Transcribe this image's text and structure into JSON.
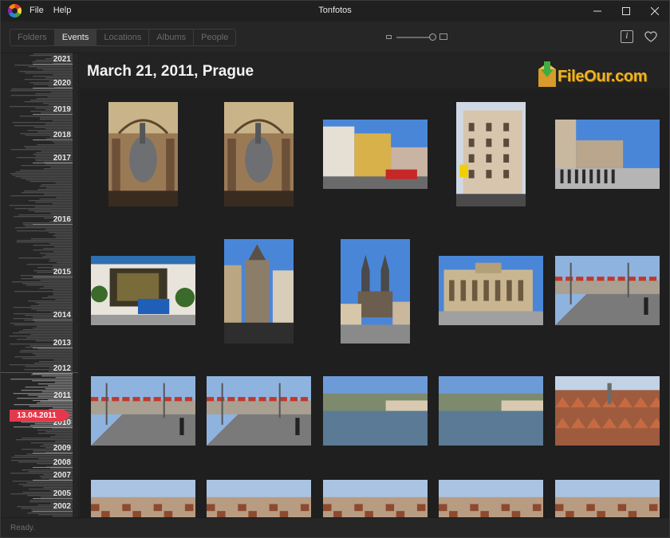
{
  "titlebar": {
    "title": "Tonfotos",
    "menu": [
      {
        "label": "File"
      },
      {
        "label": "Help"
      }
    ]
  },
  "toolbar": {
    "tabs": [
      {
        "label": "Folders",
        "active": false
      },
      {
        "label": "Events",
        "active": true
      },
      {
        "label": "Locations",
        "active": false
      },
      {
        "label": "Albums",
        "active": false
      },
      {
        "label": "People",
        "active": false
      }
    ],
    "info_label": "i"
  },
  "timeline": {
    "years": [
      "2021",
      "2020",
      "2019",
      "2018",
      "2017",
      "2016",
      "2015",
      "2014",
      "2013",
      "2012",
      "2011",
      "2010",
      "2009",
      "2008",
      "2007",
      "2005",
      "2002"
    ],
    "current_date": "13.04.2011"
  },
  "event": {
    "title": "March 21, 2011, Prague"
  },
  "watermark": {
    "text": "FileOur.com"
  },
  "photos": [
    {
      "name": "photo-horse-sculpture-1",
      "scene": "sculpture"
    },
    {
      "name": "photo-horse-sculpture-2",
      "scene": "sculpture"
    },
    {
      "name": "photo-street-buildings-tram",
      "scene": "street"
    },
    {
      "name": "photo-corner-building",
      "scene": "building"
    },
    {
      "name": "photo-wenceslas-square",
      "scene": "square"
    },
    {
      "name": "photo-shop-blue-bench",
      "scene": "shop"
    },
    {
      "name": "photo-old-town-tower",
      "scene": "tower"
    },
    {
      "name": "photo-tyn-church",
      "scene": "church"
    },
    {
      "name": "photo-rudolfinum",
      "scene": "hall"
    },
    {
      "name": "photo-bridge-castle-view",
      "scene": "bridge"
    },
    {
      "name": "photo-bridge-walkers-1",
      "scene": "bridge"
    },
    {
      "name": "photo-bridge-walkers-2",
      "scene": "bridge"
    },
    {
      "name": "photo-vltava-river-1",
      "scene": "river"
    },
    {
      "name": "photo-vltava-river-2",
      "scene": "river"
    },
    {
      "name": "photo-rooftops-panorama",
      "scene": "roofs"
    },
    {
      "name": "photo-city-panorama-1",
      "scene": "panorama"
    },
    {
      "name": "photo-city-panorama-2",
      "scene": "panorama"
    },
    {
      "name": "photo-city-panorama-3",
      "scene": "panorama"
    },
    {
      "name": "photo-city-panorama-4",
      "scene": "panorama"
    },
    {
      "name": "photo-city-panorama-5",
      "scene": "panorama"
    }
  ],
  "status": {
    "text": "Ready."
  },
  "colors": {
    "accent_marker": "#e5384a",
    "watermark": "#f0b323"
  }
}
